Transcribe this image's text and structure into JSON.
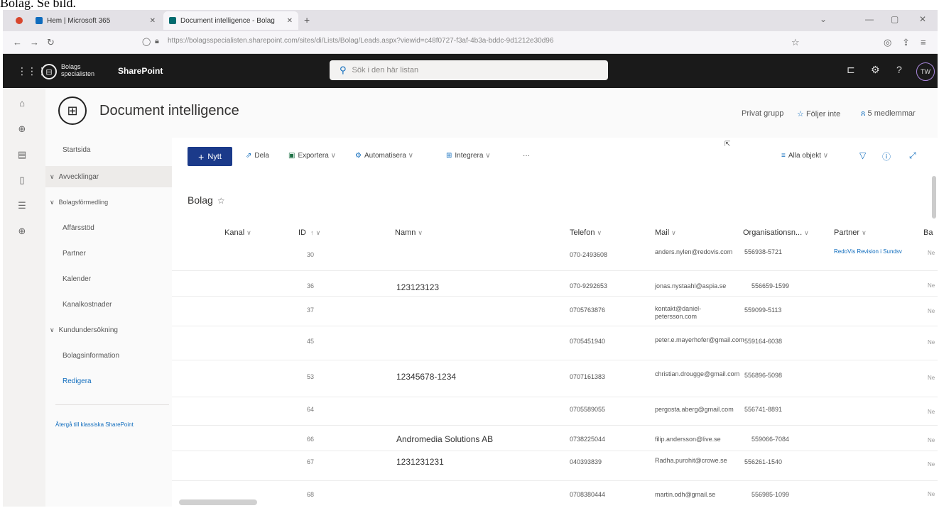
{
  "caption": "Bolag. Se bild.",
  "browser": {
    "tabs": [
      {
        "label": "Hem | Microsoft 365"
      },
      {
        "label": "Document intelligence - Bolag"
      }
    ],
    "url": "https://bolagsspecialisten.sharepoint.com/sites/di/Lists/Bolag/Leads.aspx?viewid=c48f0727-f3af-4b3a-bddc-9d1212e30d96"
  },
  "suitebar": {
    "brand_line1": "Bolags",
    "brand_line2": "specialisten",
    "app_name": "SharePoint",
    "search_placeholder": "Sök i den här listan",
    "avatar": "TW"
  },
  "site": {
    "title": "Document intelligence",
    "privacy": "Privat grupp",
    "follow": "Följer inte",
    "members": "5 medlemmar"
  },
  "nav": {
    "items": [
      {
        "label": "Startsida"
      },
      {
        "label": "Avvecklingar"
      },
      {
        "label": "Bolagsförmedling"
      },
      {
        "label": "Affärsstöd"
      },
      {
        "label": "Partner"
      },
      {
        "label": "Kalender"
      },
      {
        "label": "Kanalkostnader"
      },
      {
        "label": "Kundundersökning"
      },
      {
        "label": "Bolagsinformation"
      },
      {
        "label": "Redigera"
      },
      {
        "label": "Återgå till klassiska SharePoint"
      }
    ]
  },
  "commands": {
    "new": "Nytt",
    "share": "Dela",
    "export": "Exportera",
    "automate": "Automatisera",
    "integrate": "Integrera",
    "more": "···",
    "view": "Alla objekt"
  },
  "list": {
    "title": "Bolag",
    "columns": {
      "kanal": "Kanal",
      "id": "ID",
      "namn": "Namn",
      "telefon": "Telefon",
      "mail": "Mail",
      "org": "Organisationsn...",
      "partner": "Partner",
      "ba": "Ba"
    },
    "rows": [
      {
        "id": "30",
        "namn": "",
        "telefon": "070-2493608",
        "mail": "anders.nylen@redovis.com",
        "org": "556938-5721",
        "partner": "RedoVis Revision i Sundsv",
        "ba": "Ne"
      },
      {
        "id": "36",
        "namn": "123123123",
        "telefon": "070-9292653",
        "mail": "jonas.nystaahl@aspia.se",
        "org": "556659-1599",
        "partner": "",
        "ba": "Ne"
      },
      {
        "id": "37",
        "namn": "",
        "telefon": "0705763876",
        "mail": "kontakt@daniel-petersson.com",
        "org": "559099-5113",
        "partner": "",
        "ba": "Ne"
      },
      {
        "id": "45",
        "namn": "",
        "telefon": "0705451940",
        "mail": "peter.e.mayerhofer@gmail.com",
        "org": "559164-6038",
        "partner": "",
        "ba": "Ne"
      },
      {
        "id": "53",
        "namn": "12345678-1234",
        "telefon": "0707161383",
        "mail": "christian.drougge@gmail.com",
        "org": "556896-5098",
        "partner": "",
        "ba": "Ne"
      },
      {
        "id": "64",
        "namn": "",
        "telefon": "0705589055",
        "mail": "pergosta.aberg@gmail.com",
        "org": "556741-8891",
        "partner": "",
        "ba": "Ne"
      },
      {
        "id": "66",
        "namn": "Andromedia Solutions AB",
        "telefon": "0738225044",
        "mail": "filip.andersson@live.se",
        "org": "559066-7084",
        "partner": "",
        "ba": "Ne"
      },
      {
        "id": "67",
        "namn": "1231231231",
        "telefon": "040393839",
        "mail": "Radha.purohit@crowe.se",
        "org": "556261-1540",
        "partner": "",
        "ba": "Ne"
      },
      {
        "id": "68",
        "namn": "",
        "telefon": "0708380444",
        "mail": "martin.odh@gmail.se",
        "org": "556985-1099",
        "partner": "",
        "ba": "Ne"
      }
    ]
  }
}
